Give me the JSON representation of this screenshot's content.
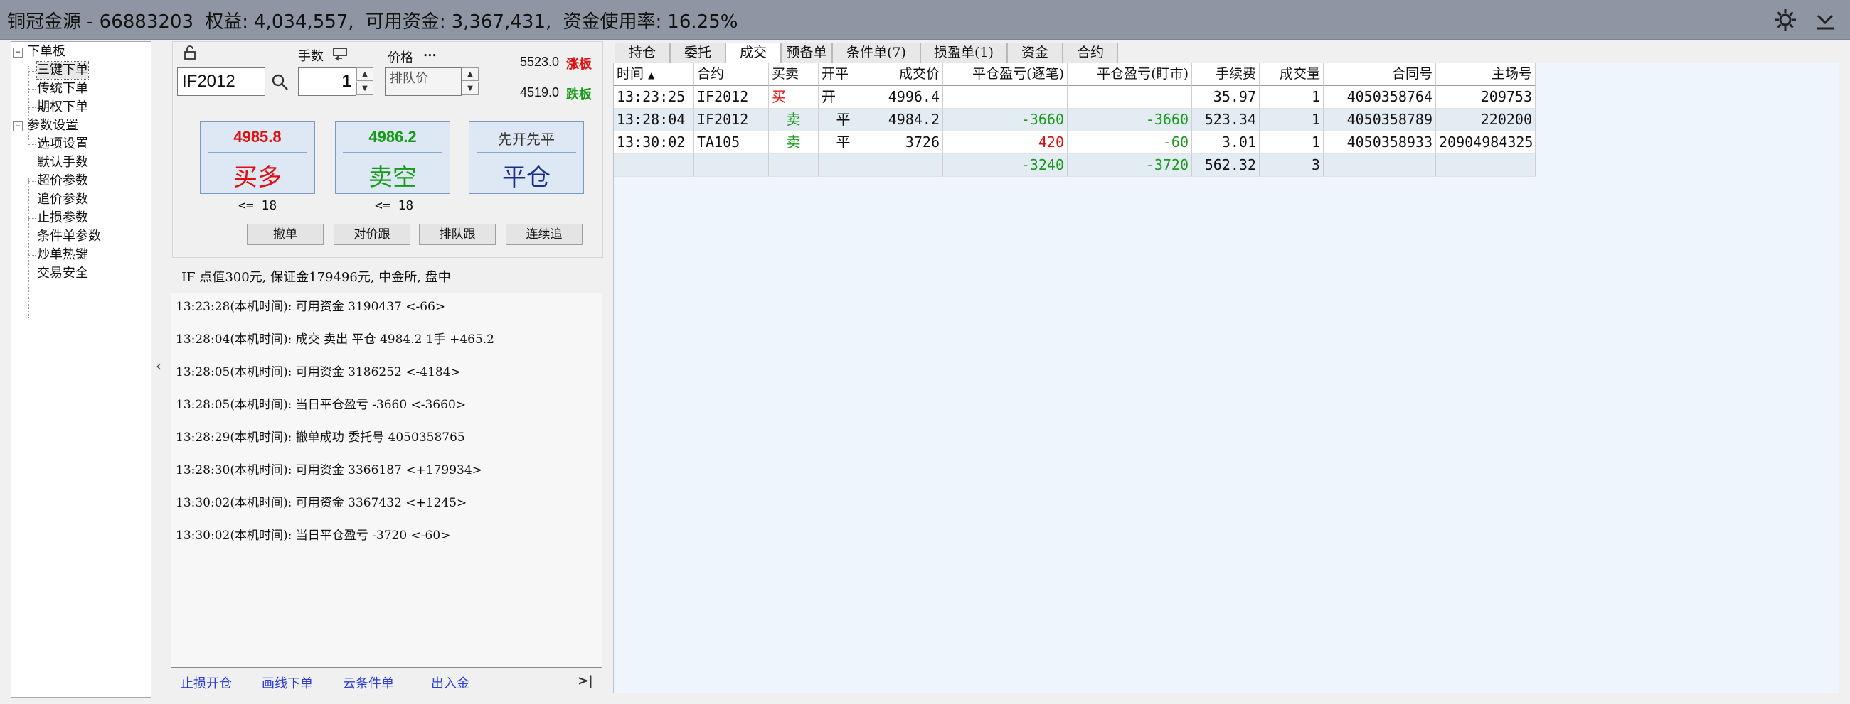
{
  "header": {
    "app_name": "铜冠金源",
    "account": "- 66883203",
    "equity_label": "权益:",
    "equity": "4,034,557,",
    "available_label": "可用资金:",
    "available": "3,367,431,",
    "usage_label": "资金使用率:",
    "usage": "16.25%",
    "icons": [
      "gear-icon",
      "minimize-icon"
    ]
  },
  "tree": {
    "groups": [
      {
        "label": "下单板",
        "expanded": true,
        "items": [
          "三键下单",
          "传统下单",
          "期权下单"
        ],
        "selected": 0
      },
      {
        "label": "参数设置",
        "expanded": true,
        "items": [
          "选项设置",
          "默认手数",
          "超价参数",
          "追价参数",
          "止损参数",
          "条件单参数",
          "炒单热键",
          "交易安全"
        ]
      }
    ]
  },
  "order": {
    "lots_label": "手数",
    "price_label": "价格",
    "price_more": "...",
    "contract": "IF2012",
    "lots": "1",
    "price_mode": "排队价",
    "limit_up": "5523.0",
    "limit_up_label": "涨板",
    "limit_down": "4519.0",
    "limit_down_label": "跌板",
    "buy_price": "4985.8",
    "buy_label": "买多",
    "sell_price": "4986.2",
    "sell_label": "卖空",
    "close_top": "先开先平",
    "close_label": "平仓",
    "buy_limit": "<= 18",
    "sell_limit": "<= 18",
    "actions": [
      "撤单",
      "对价跟",
      "排队跟",
      "连续追"
    ]
  },
  "info_line": "IF  点值300元, 保证金179496元,  中金所,  盘中",
  "log": [
    "13:23:28(本机时间): 可用资金 3190437  <-66>",
    "13:28:04(本机时间): 成交  卖出  平仓  4984.2  1手  +465.2",
    "13:28:05(本机时间): 可用资金 3186252  <-4184>",
    "13:28:05(本机时间): 当日平仓盈亏 -3660  <-3660>",
    "13:28:29(本机时间): 撤单成功  委托号  4050358765",
    "13:28:30(本机时间): 可用资金 3366187  <+179934>",
    "13:30:02(本机时间): 可用资金 3367432  <+1245>",
    "13:30:02(本机时间): 当日平仓盈亏 -3720  <-60>"
  ],
  "bottom_links": [
    "止损开仓",
    "画线下单",
    "云条件单",
    "出入金"
  ],
  "bottom_end": ">|",
  "collapse_arrow": "‹",
  "tabs": [
    "持仓",
    "委托",
    "成交",
    "预备单",
    "条件单(7)",
    "损盈单(1)",
    "资金",
    "合约"
  ],
  "active_tab": 2,
  "grid": {
    "columns": [
      "时间",
      "合约",
      "买卖",
      "开平",
      "成交价",
      "平仓盈亏(逐笔)",
      "平仓盈亏(盯市)",
      "手续费",
      "成交量",
      "合同号",
      "主场号"
    ],
    "sort_indicator": "▲",
    "rows": [
      [
        "13:23:25",
        "IF2012",
        "买",
        "开",
        "4996.4",
        "",
        "",
        "35.97",
        "1",
        "4050358764",
        "209753"
      ],
      [
        "13:28:04",
        "IF2012",
        "卖",
        "平",
        "4984.2",
        "-3660",
        "-3660",
        "523.34",
        "1",
        "4050358789",
        "220200"
      ],
      [
        "13:30:02",
        "TA105",
        "卖",
        "平",
        "3726",
        "420",
        "-60",
        "3.01",
        "1",
        "4050358933",
        "20904984325"
      ],
      [
        "",
        "",
        "",
        "",
        "",
        "-3240",
        "-3720",
        "562.32",
        "3",
        "",
        ""
      ]
    ]
  },
  "colors": {
    "up": "#e11010",
    "down": "#1a9a1a",
    "header_bg": "#8d96a2",
    "grid_bg": "#eef5fc"
  }
}
